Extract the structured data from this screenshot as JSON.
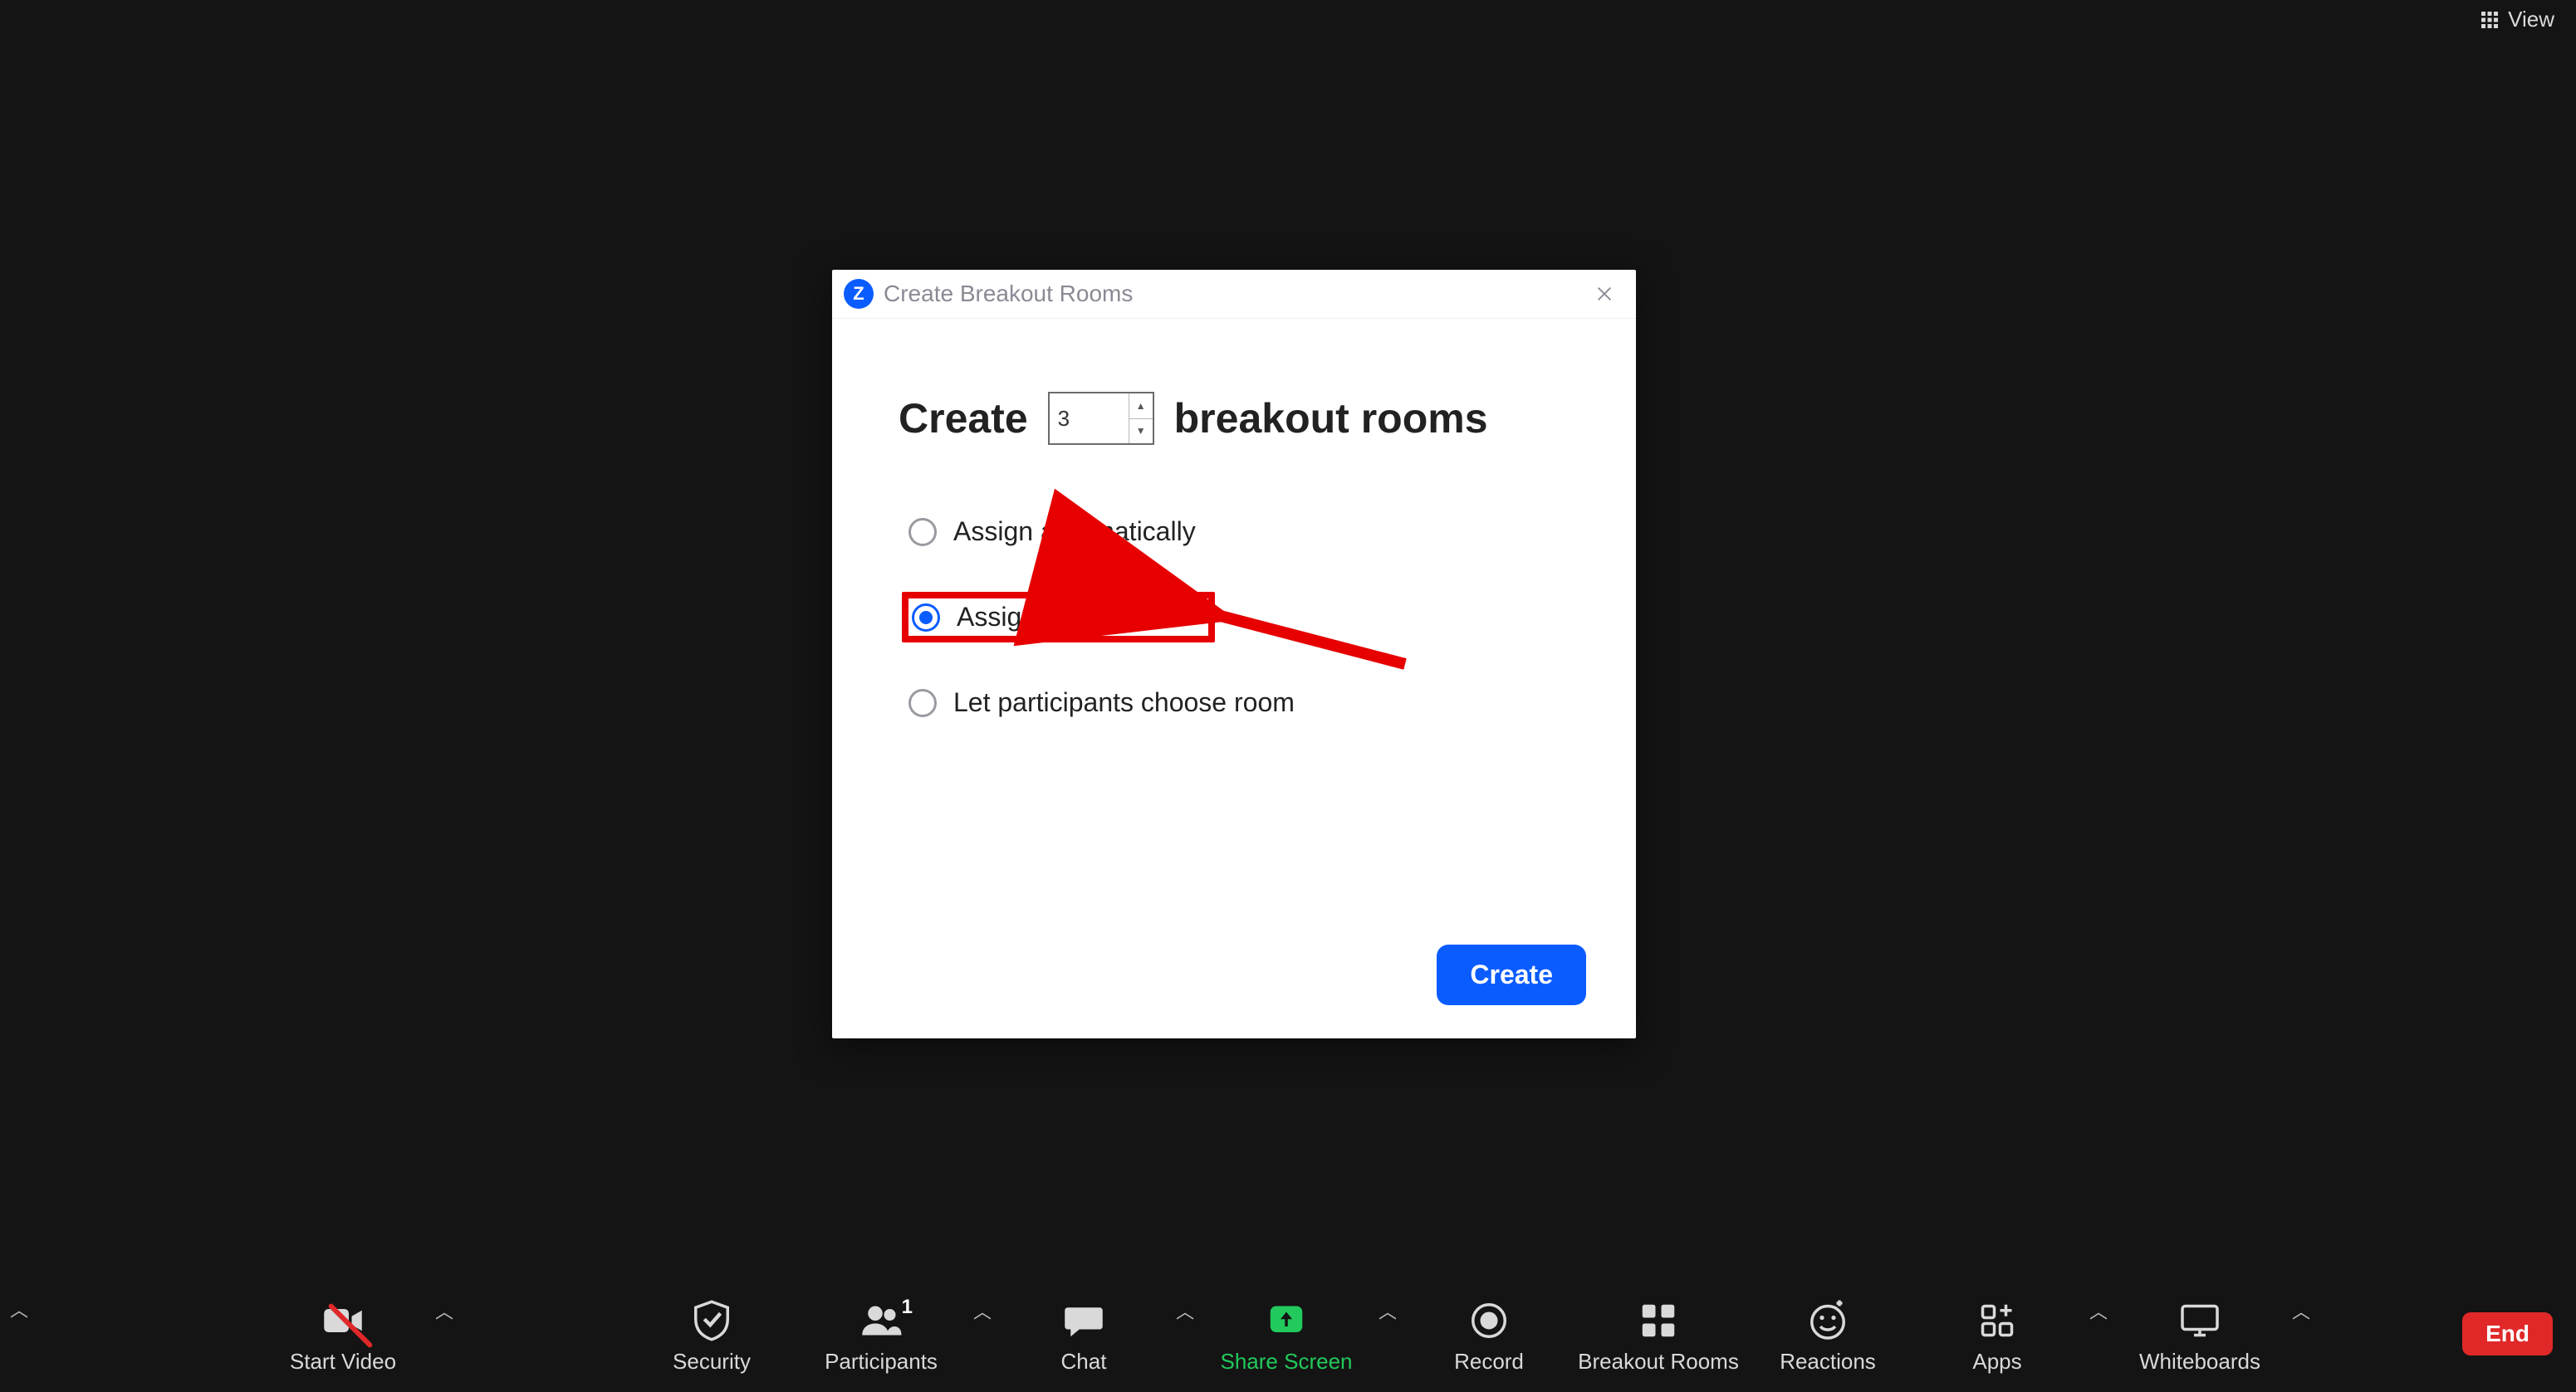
{
  "topbar": {
    "view_label": "View"
  },
  "modal": {
    "title": "Create Breakout Rooms",
    "heading_prefix": "Create",
    "heading_suffix": "breakout rooms",
    "room_count": "3",
    "options": [
      {
        "id": "auto",
        "label": "Assign automatically",
        "selected": false,
        "highlighted": false
      },
      {
        "id": "manual",
        "label": "Assign manually",
        "selected": true,
        "highlighted": true
      },
      {
        "id": "choose",
        "label": "Let participants choose room",
        "selected": false,
        "highlighted": false
      }
    ],
    "create_label": "Create"
  },
  "toolbar": {
    "start_video": "Start Video",
    "security": "Security",
    "participants": "Participants",
    "participants_count": "1",
    "chat": "Chat",
    "share_screen": "Share Screen",
    "record": "Record",
    "breakout_rooms": "Breakout Rooms",
    "reactions": "Reactions",
    "apps": "Apps",
    "whiteboards": "Whiteboards",
    "end": "End"
  },
  "annotation": {
    "highlight_color": "#e60000"
  }
}
